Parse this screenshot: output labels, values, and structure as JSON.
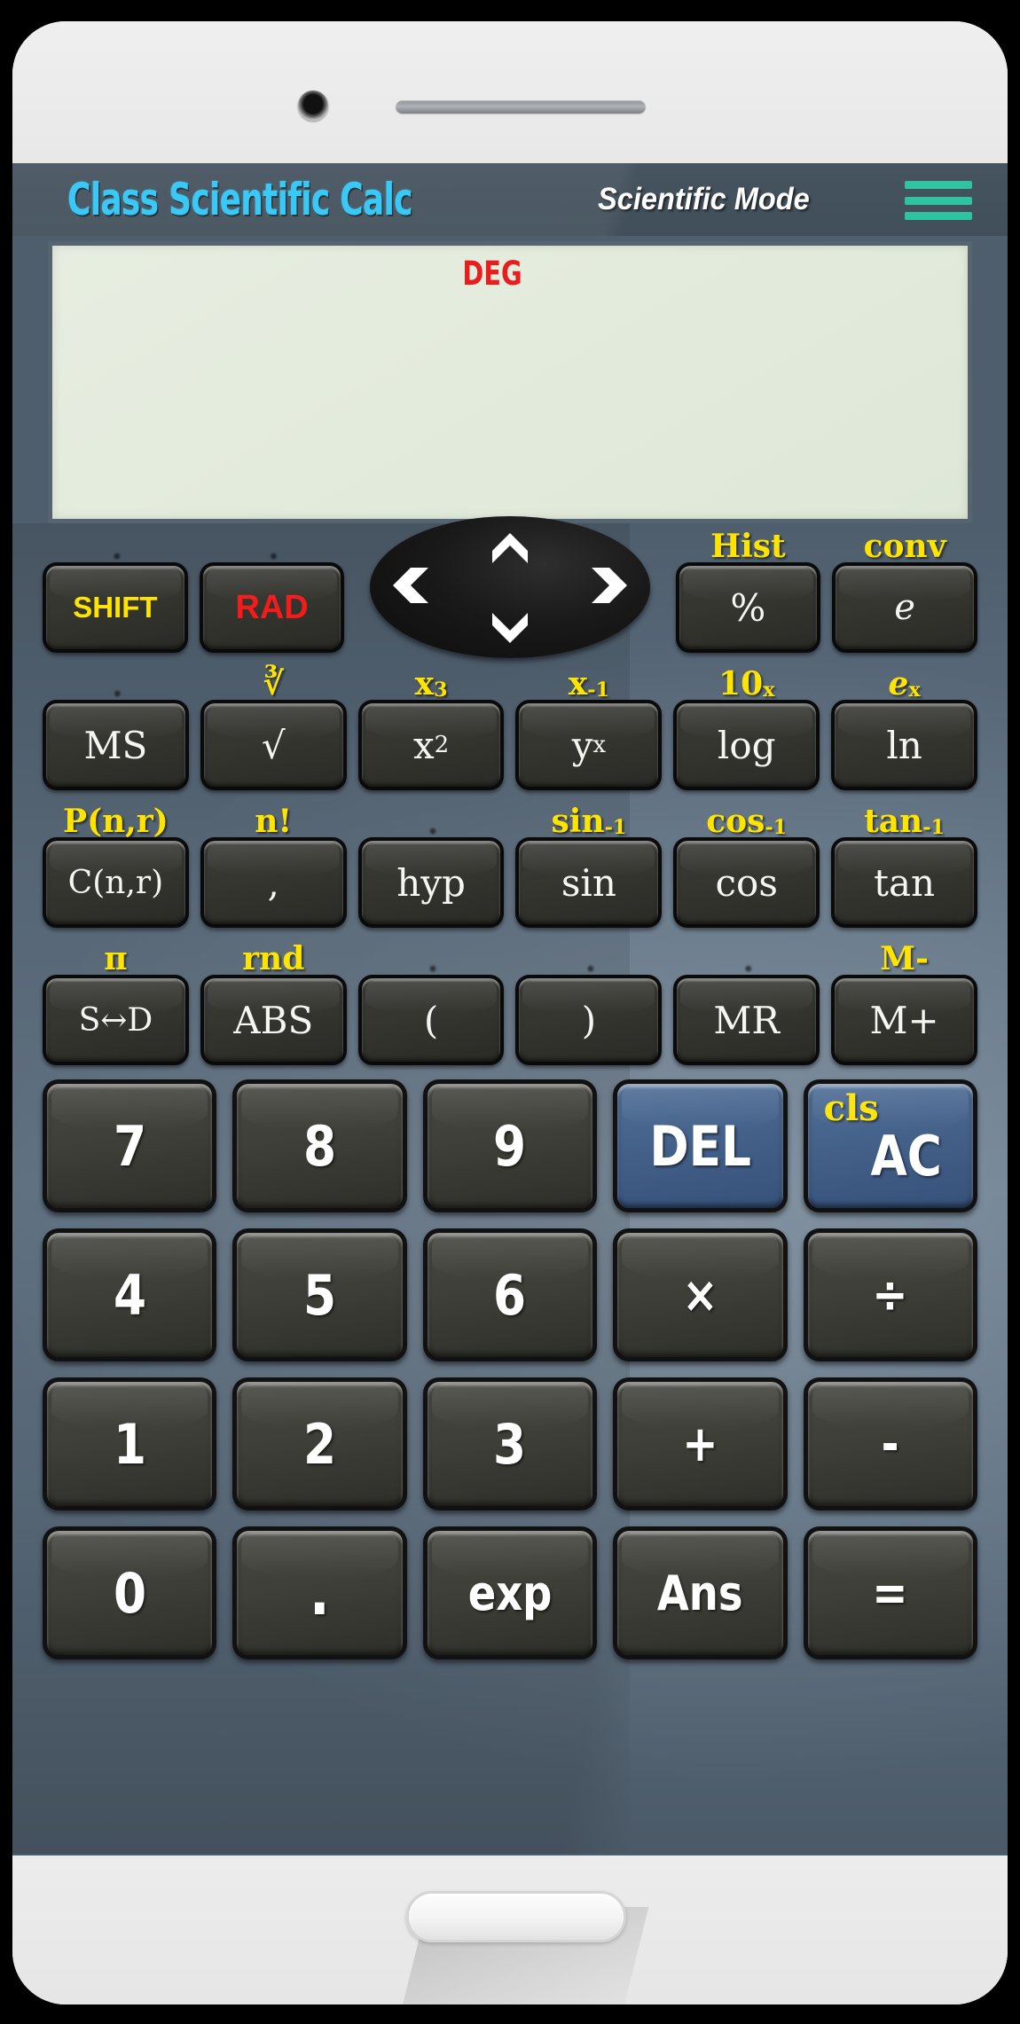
{
  "header": {
    "app_title": "Class Scientific Calc",
    "mode": "Scientific Mode",
    "menu_icon": "hamburger-menu-icon"
  },
  "display": {
    "angle_mode": "DEG",
    "value": ""
  },
  "dpad": {
    "up": "chevron-up-icon",
    "down": "chevron-down-icon",
    "left": "chevron-left-icon",
    "right": "chevron-right-icon"
  },
  "sci_rows": [
    {
      "keys": [
        {
          "label": "SHIFT",
          "second": "",
          "style": "shift-key"
        },
        {
          "label": "RAD",
          "second": "",
          "style": "rad-key"
        },
        {
          "label": "%",
          "second": "Hist",
          "style": ""
        },
        {
          "label": "e",
          "second": "conv",
          "style": "italic-e"
        }
      ]
    },
    {
      "keys": [
        {
          "label": "MS",
          "second": "",
          "style": ""
        },
        {
          "label": "√",
          "second": "∛",
          "style": ""
        },
        {
          "label": "x2",
          "second": "x3",
          "style": ""
        },
        {
          "label": "yx",
          "second": "x-1",
          "style": ""
        },
        {
          "label": "log",
          "second": "10x",
          "style": ""
        },
        {
          "label": "ln",
          "second": "ex",
          "style": ""
        }
      ]
    },
    {
      "keys": [
        {
          "label": "C(n,r)",
          "second": "P(n,r)",
          "style": "small"
        },
        {
          "label": ",",
          "second": "n!",
          "style": ""
        },
        {
          "label": "hyp",
          "second": "",
          "style": ""
        },
        {
          "label": "sin",
          "second": "sin-1",
          "style": ""
        },
        {
          "label": "cos",
          "second": "cos-1",
          "style": ""
        },
        {
          "label": "tan",
          "second": "tan-1",
          "style": ""
        }
      ]
    },
    {
      "keys": [
        {
          "label": "S↔D",
          "second": "π",
          "style": "small"
        },
        {
          "label": "ABS",
          "second": "rnd",
          "style": ""
        },
        {
          "label": "(",
          "second": "",
          "style": ""
        },
        {
          "label": ")",
          "second": "",
          "style": ""
        },
        {
          "label": "MR",
          "second": "",
          "style": ""
        },
        {
          "label": "M+",
          "second": "M-",
          "style": ""
        }
      ]
    }
  ],
  "num_rows": [
    [
      {
        "label": "7",
        "variant": "num"
      },
      {
        "label": "8",
        "variant": "num"
      },
      {
        "label": "9",
        "variant": "num"
      },
      {
        "label": "DEL",
        "variant": "blue"
      },
      {
        "label": "AC",
        "variant": "blue",
        "second": "cls"
      }
    ],
    [
      {
        "label": "4",
        "variant": "num"
      },
      {
        "label": "5",
        "variant": "num"
      },
      {
        "label": "6",
        "variant": "num"
      },
      {
        "label": "×",
        "variant": "op"
      },
      {
        "label": "÷",
        "variant": "op"
      }
    ],
    [
      {
        "label": "1",
        "variant": "num"
      },
      {
        "label": "2",
        "variant": "num"
      },
      {
        "label": "3",
        "variant": "num"
      },
      {
        "label": "+",
        "variant": "op"
      },
      {
        "label": "-",
        "variant": "op"
      }
    ],
    [
      {
        "label": "0",
        "variant": "num"
      },
      {
        "label": ".",
        "variant": "dot"
      },
      {
        "label": "exp",
        "variant": "sm"
      },
      {
        "label": "Ans",
        "variant": "sm"
      },
      {
        "label": "=",
        "variant": "op"
      }
    ]
  ],
  "colors": {
    "accent_title": "#2fc6f7",
    "menu_green": "#2ec4a0",
    "secondary_label": "#ffe400",
    "rad_red": "#f51b1b",
    "deg_red": "#e81e1e",
    "blue_key": "#44618a",
    "keypad_bg": "#5f7182",
    "lcd_bg": "#e3ebdd"
  }
}
